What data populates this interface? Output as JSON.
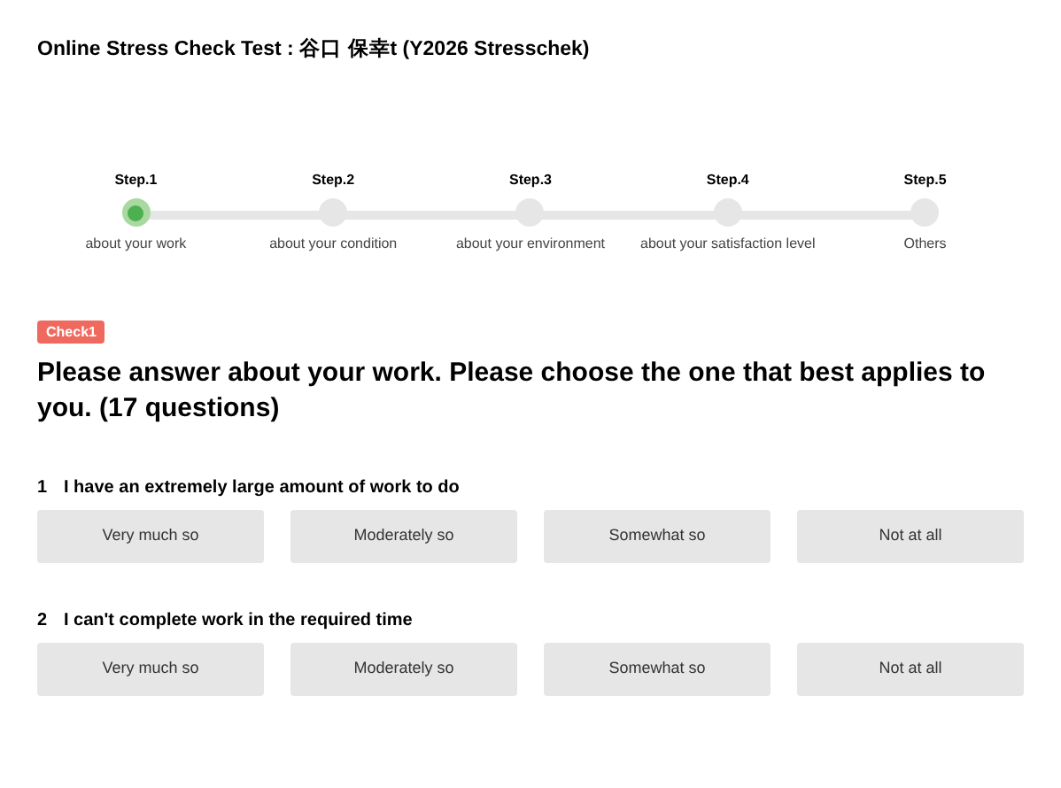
{
  "title": "Online Stress Check Test : 谷口 保幸t (Y2026 Stresschek)",
  "steps": [
    {
      "step": "Step.1",
      "label": "about your work",
      "selected": true
    },
    {
      "step": "Step.2",
      "label": "about your condition",
      "selected": false
    },
    {
      "step": "Step.3",
      "label": "about your environment",
      "selected": false
    },
    {
      "step": "Step.4",
      "label": "about your satisfaction level",
      "selected": false
    },
    {
      "step": "Step.5",
      "label": "Others",
      "selected": false
    }
  ],
  "badge": "Check1",
  "heading": "Please answer about your work. Please choose the one that best applies to you. (17 questions)",
  "questions": [
    {
      "number": "1",
      "text": "I have an extremely large amount of work to do",
      "options": [
        {
          "label": "Very much so",
          "selected": false
        },
        {
          "label": "Moderately so",
          "selected": false
        },
        {
          "label": "Somewhat so",
          "selected": false
        },
        {
          "label": "Not at all",
          "selected": false
        }
      ]
    },
    {
      "number": "2",
      "text": "I can't complete work in the required time",
      "options": [
        {
          "label": "Very much so",
          "selected": false
        },
        {
          "label": "Moderately so",
          "selected": false
        },
        {
          "label": "Somewhat so",
          "selected": false
        },
        {
          "label": "Not at all",
          "selected": false
        }
      ]
    }
  ]
}
